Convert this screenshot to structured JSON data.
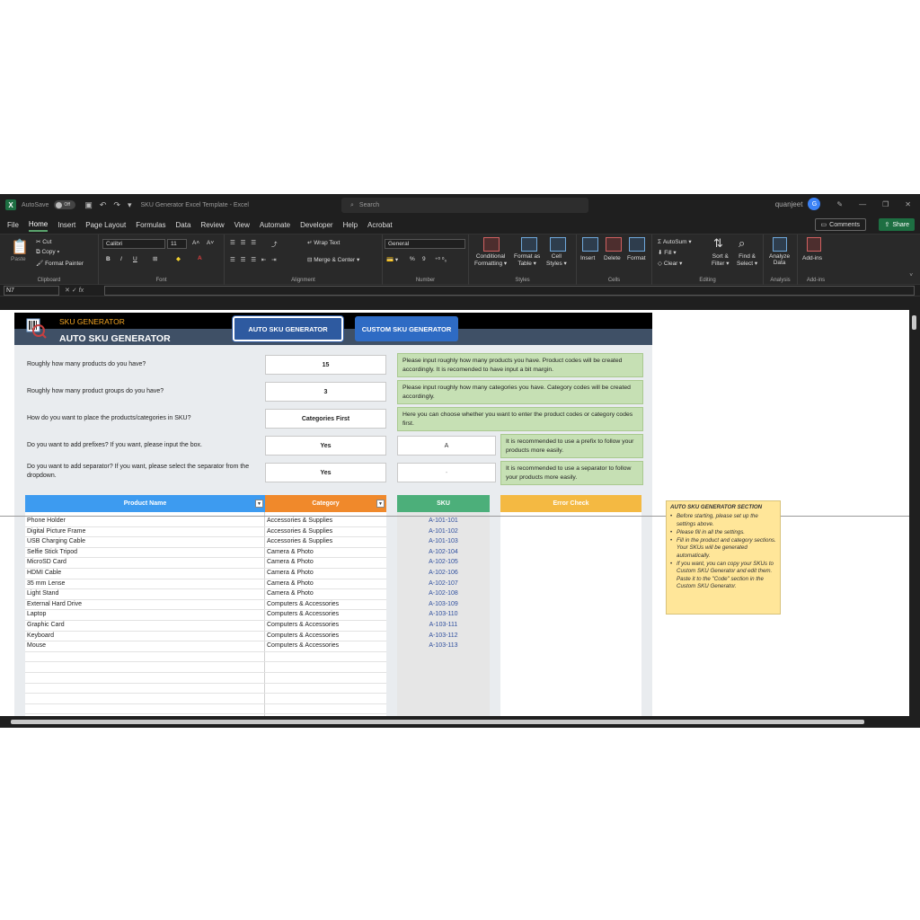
{
  "titlebar": {
    "autosave": "AutoSave",
    "autosave_state": "Off",
    "doc_title": "SKU Generator Excel Template - Excel",
    "search_placeholder": "Search",
    "user_name": "quanjeet",
    "user_initial": "G"
  },
  "menu": {
    "tabs": [
      "File",
      "Home",
      "Insert",
      "Page Layout",
      "Formulas",
      "Data",
      "Review",
      "View",
      "Automate",
      "Developer",
      "Help",
      "Acrobat"
    ],
    "active": "Home",
    "comments": "Comments",
    "share": "Share"
  },
  "ribbon": {
    "paste": "Paste",
    "cut": "Cut",
    "copy": "Copy",
    "format_painter": "Format Painter",
    "clipboard": "Clipboard",
    "font_name": "Calibri",
    "font_size": "11",
    "bold": "B",
    "italic": "I",
    "underline": "U",
    "font": "Font",
    "wrap_text": "Wrap Text",
    "merge_center": "Merge & Center",
    "alignment": "Alignment",
    "number_format": "General",
    "percent": "%",
    "comma": "9",
    "number": "Number",
    "conditional": "Conditional",
    "formatting": "Formatting",
    "format_as": "Format as",
    "table": "Table",
    "cell": "Cell",
    "styles_btn": "Styles",
    "styles": "Styles",
    "insert": "Insert",
    "delete": "Delete",
    "format": "Format",
    "cells": "Cells",
    "autosum": "AutoSum",
    "fill": "Fill",
    "clear": "Clear",
    "sort_filter": "Sort &",
    "sort_filter2": "Filter",
    "find_select": "Find &",
    "find_select2": "Select",
    "editing": "Editing",
    "analyze": "Analyze",
    "analyze2": "Data",
    "analysis": "Analysis",
    "addins": "Add-ins",
    "addins_group": "Add-ins"
  },
  "formula_bar": {
    "cell_ref": "N7",
    "fx": "fx"
  },
  "header": {
    "small_title": "SKU GENERATOR",
    "big_title": "AUTO SKU GENERATOR",
    "btn_auto": "AUTO SKU GENERATOR",
    "btn_custom": "CUSTOM SKU GENERATOR"
  },
  "settings": {
    "q1": "Roughly how many products do you have?",
    "a1": "15",
    "n1": "Please input roughly how many products you have. Product codes will be created accordingly. It is recomended to have input a bit margin.",
    "q2": "Roughly how many product groups do you have?",
    "a2": "3",
    "n2": "Please input roughly how many categories you have. Category codes will be created accordingly.",
    "q3": "How do you want to place the products/categories in SKU?",
    "a3": "Categories First",
    "n3": "Here you can choose whether you want to enter the product codes or category codes first.",
    "q4": "Do you want to add prefixes? If you want, please input the box.",
    "a4": "Yes",
    "a4b": "A",
    "n4": "It is recommended to use a prefix to follow your products more easily.",
    "q5": "Do you want to add separator? If you want, please select the separator from the dropdown.",
    "a5": "Yes",
    "a5b": "-",
    "n5": "It is recommended to use a separator to follow your products more easily."
  },
  "table": {
    "headers": {
      "product": "Product Name",
      "category": "Category",
      "sku": "SKU",
      "error": "Error Check"
    },
    "rows": [
      {
        "product": "Phone Holder",
        "category": "Accessories & Supplies",
        "sku": "A-101-101"
      },
      {
        "product": "Digital Picture Frame",
        "category": "Accessories & Supplies",
        "sku": "A-101-102"
      },
      {
        "product": "USB Charging Cable",
        "category": "Accessories & Supplies",
        "sku": "A-101-103"
      },
      {
        "product": "Selfie Stick Tripod",
        "category": "Camera & Photo",
        "sku": "A-102-104"
      },
      {
        "product": "MicroSD Card",
        "category": "Camera & Photo",
        "sku": "A-102-105"
      },
      {
        "product": "HDMI Cable",
        "category": "Camera & Photo",
        "sku": "A-102-106"
      },
      {
        "product": "35 mm Lense",
        "category": "Camera & Photo",
        "sku": "A-102-107"
      },
      {
        "product": "Light Stand",
        "category": "Camera & Photo",
        "sku": "A-102-108"
      },
      {
        "product": "External Hard Drive",
        "category": "Computers & Accessories",
        "sku": "A-103-109"
      },
      {
        "product": "Laptop",
        "category": "Computers & Accessories",
        "sku": "A-103-110"
      },
      {
        "product": "Graphic Card",
        "category": "Computers & Accessories",
        "sku": "A-103-111"
      },
      {
        "product": "Keyboard",
        "category": "Computers & Accessories",
        "sku": "A-103-112"
      },
      {
        "product": "Mouse",
        "category": "Computers & Accessories",
        "sku": "A-103-113"
      }
    ]
  },
  "side_note": {
    "title": "AUTO SKU GENERATOR SECTION",
    "items": [
      "Before starting, please set up the settings above.",
      "Please fill in all the settings.",
      "Fill in the product and category sections. Your SKUs will be generated automatically.",
      "If you want, you can copy your SKUs to Custom SKU Generator and edit them. Paste it to the \"Code\" section in the Custom SKU Generator."
    ]
  },
  "colors": {
    "product_header": "#3d9bf0",
    "category_header": "#f0892b",
    "sku_header": "#4caf7a",
    "error_header": "#f4b942"
  }
}
